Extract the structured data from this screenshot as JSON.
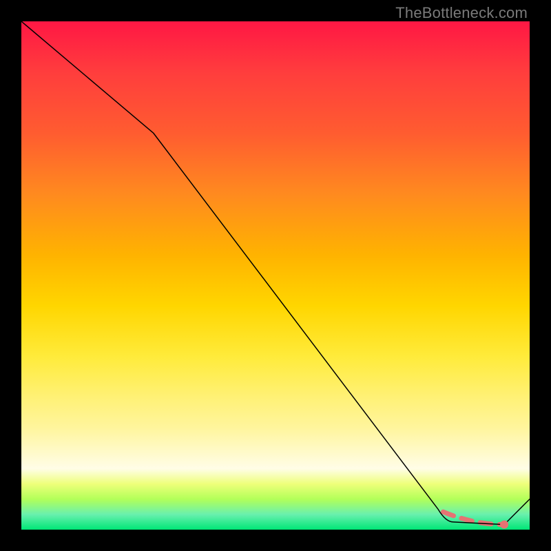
{
  "attribution": "TheBottleneck.com",
  "colors": {
    "curve": "#000000",
    "marker": "#e57373",
    "dashed": "#e57373"
  },
  "chart_data": {
    "type": "line",
    "title": "",
    "xlabel": "",
    "ylabel": "",
    "xlim": [
      0,
      100
    ],
    "ylim": [
      0,
      100
    ],
    "series": [
      {
        "name": "bottleneck-curve",
        "description": "Black curve descending from top-left to a flat valley near bottom-right then rising",
        "points": [
          {
            "x": 0,
            "y": 100
          },
          {
            "x": 26,
            "y": 78
          },
          {
            "x": 82,
            "y": 4
          },
          {
            "x": 85,
            "y": 1.5
          },
          {
            "x": 95,
            "y": 1
          },
          {
            "x": 100,
            "y": 6
          }
        ]
      },
      {
        "name": "optimal-region",
        "description": "Pink dashed highlight over valley floor",
        "points": [
          {
            "x": 83,
            "y": 3.5
          },
          {
            "x": 95,
            "y": 1
          }
        ]
      }
    ],
    "markers": [
      {
        "name": "optimal-point",
        "x": 95,
        "y": 1
      }
    ]
  }
}
